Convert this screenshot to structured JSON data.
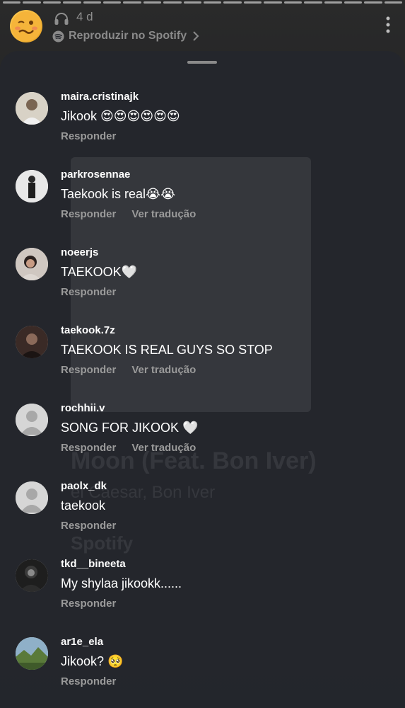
{
  "story": {
    "time": "4 d",
    "spotify_link": "Reproduzir no Spotify",
    "progress_segments": 20
  },
  "comments": [
    {
      "username": "maira.cristinajk",
      "text": "Jikook 😍😍😍😍😍😍",
      "actions": [
        "Responder"
      ]
    },
    {
      "username": "parkrosennae",
      "text": "Taekook is real😭😭",
      "actions": [
        "Responder",
        "Ver tradução"
      ]
    },
    {
      "username": "noeerjs",
      "text": "TAEKOOK🤍",
      "actions": [
        "Responder"
      ]
    },
    {
      "username": "taekook.7z",
      "text": "TAEKOOK IS REAL GUYS SO STOP",
      "actions": [
        "Responder",
        "Ver tradução"
      ]
    },
    {
      "username": "rochhii.v",
      "text": "SONG FOR JIKOOK 🤍",
      "actions": [
        "Responder",
        "Ver tradução"
      ]
    },
    {
      "username": "paolx_dk",
      "text": "taekook",
      "actions": [
        "Responder"
      ]
    },
    {
      "username": "tkd__bineeta",
      "text": "My shylaa jikookk......",
      "actions": [
        "Responder"
      ]
    },
    {
      "username": "ar1e_ela",
      "text": "Jikook? 🥺",
      "actions": [
        "Responder"
      ]
    }
  ],
  "background_art": {
    "moon_label": "MOON",
    "title": "Moon (Feat. Bon Iver)",
    "artist": "el Caesar, Bon Iver",
    "brand": "Spotify"
  },
  "colors": {
    "sheet": "#24272d",
    "muted_text": "#9a9a9a",
    "accent_emoji": "#f6b93b"
  }
}
